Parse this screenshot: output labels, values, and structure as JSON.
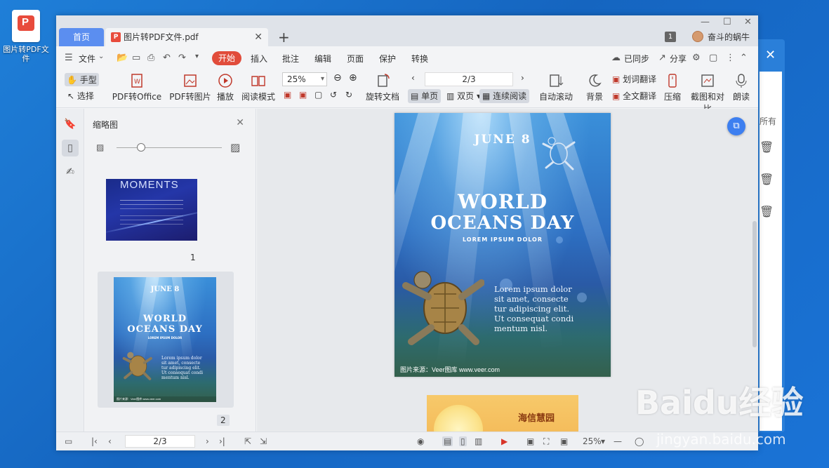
{
  "desktop": {
    "icon_label": "图片转PDF文件"
  },
  "tabs": {
    "home": "首页",
    "doc": "图片转PDF文件.pdf",
    "plus": "+"
  },
  "titlebar": {
    "badge": "1",
    "username": "奋斗的蜗牛",
    "min": "—",
    "max": "☐",
    "close": "✕"
  },
  "menu": {
    "file": "文件",
    "start": "开始",
    "items": [
      "插入",
      "批注",
      "编辑",
      "页面",
      "保护",
      "转换"
    ],
    "sync": "已同步",
    "share": "分享"
  },
  "toolbar": {
    "hand": "手型",
    "select": "选择",
    "pdf_to_office": "PDF转Office",
    "pdf_to_image": "PDF转图片",
    "play": "播放",
    "read_mode": "阅读模式",
    "zoom": "25%",
    "rotate": "旋转文档",
    "page": "2/3",
    "single": "单页",
    "double": "双页",
    "continuous": "连续阅读",
    "autoscroll": "自动滚动",
    "background": "背景",
    "word_translate": "划词翻译",
    "full_translate": "全文翻译",
    "compress": "压缩",
    "screenshot": "截图和对比",
    "read_aloud": "朗读"
  },
  "thumbs": {
    "title": "缩略图",
    "page1": "1",
    "page2": "2",
    "t1_title": "MOMENTS"
  },
  "poster": {
    "date": "JUNE 8",
    "line1": "WORLD",
    "line2": "OCEANS DAY",
    "sub": "LOREM IPSUM DOLOR",
    "para": [
      "Lorem ipsum dolor",
      "sit amet, consecte",
      "tur adipiscing elit.",
      "Ut consequat condi",
      "mentum nisl."
    ],
    "credit": "图片来源：Veer图库 www.veer.com"
  },
  "page3": {
    "brand": "海信慧园"
  },
  "side_panel": {
    "text": "所有"
  },
  "statusbar": {
    "page": "2/3",
    "zoom": "25%"
  },
  "watermark": {
    "brand": "Baidu经验",
    "url": "jingyan.baidu.com"
  }
}
